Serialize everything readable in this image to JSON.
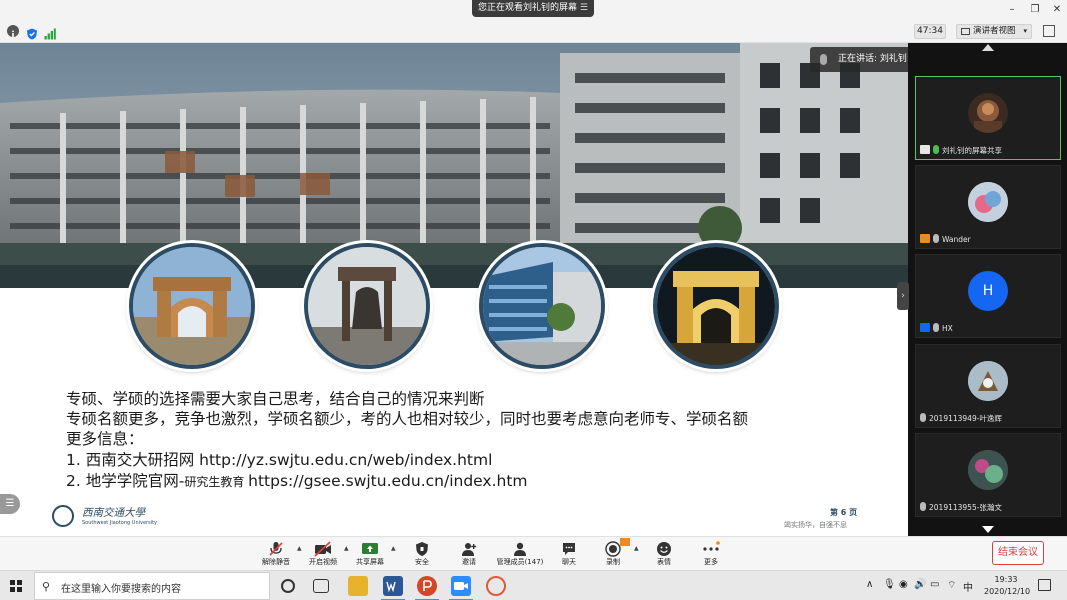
{
  "titlebar": {
    "share_label": "您正在观看刘礼钊的屏幕",
    "minimize": "–",
    "maximize": "❐",
    "close": "✕"
  },
  "toolbar": {
    "timer": "47:34",
    "view_label": "演讲者视图",
    "view_caret": "▾"
  },
  "slide": {
    "lines": [
      "专硕、学硕的选择需要大家自己思考，结合自己的情况来判断",
      "专硕名额更多，竞争也激烈，学硕名额少，考的人也相对较少，同时也要考虑意向老师专、学硕名额",
      "更多信息："
    ],
    "item1_prefix": "1.  西南交大研招网 ",
    "item1_url": "http://yz.swjtu.edu.cn/web/index.html",
    "item2_prefix": "2.  地学学院官网-",
    "item2_small": "研究生教育 ",
    "item2_url": "https://gsee.swjtu.edu.cn/index.htm",
    "university_name": "西南交通大學",
    "university_sub": "Southwest Jiaotong University",
    "page_number": "第 6 页",
    "motto": "竭实扬华，自强不息"
  },
  "speaking": {
    "label": "正在讲话: 刘礼钊:"
  },
  "participants": [
    {
      "name": "刘礼钊的屏幕共享",
      "icon_color": "#4bbf4b",
      "active": true
    },
    {
      "name": "Wander",
      "icon_color": "#f08a1c",
      "active": false
    },
    {
      "name": "HX",
      "icon_color": "#1466f3",
      "active": false,
      "avatar_letter": "H"
    },
    {
      "name": "2019113949-叶逸辉",
      "icon_color": "",
      "active": false
    },
    {
      "name": "2019113955-张瀚文",
      "icon_color": "",
      "active": false
    }
  ],
  "controls": {
    "mute": "解除静音",
    "video": "开启视频",
    "share": "共享屏幕",
    "security": "安全",
    "invite": "邀请",
    "members": "管理成员(147)",
    "chat": "聊天",
    "record": "录制",
    "reaction": "表情",
    "more": "更多",
    "end": "结束会议"
  },
  "taskbar": {
    "search_placeholder": "在这里输入你要搜索的内容",
    "ime": "中",
    "time": "19:33",
    "date": "2020/12/10"
  },
  "colors": {
    "accent_blue": "#1466f3",
    "end_red": "#e03e3e",
    "active_green": "#5fc06a",
    "slide_navy": "#2c4b64"
  }
}
